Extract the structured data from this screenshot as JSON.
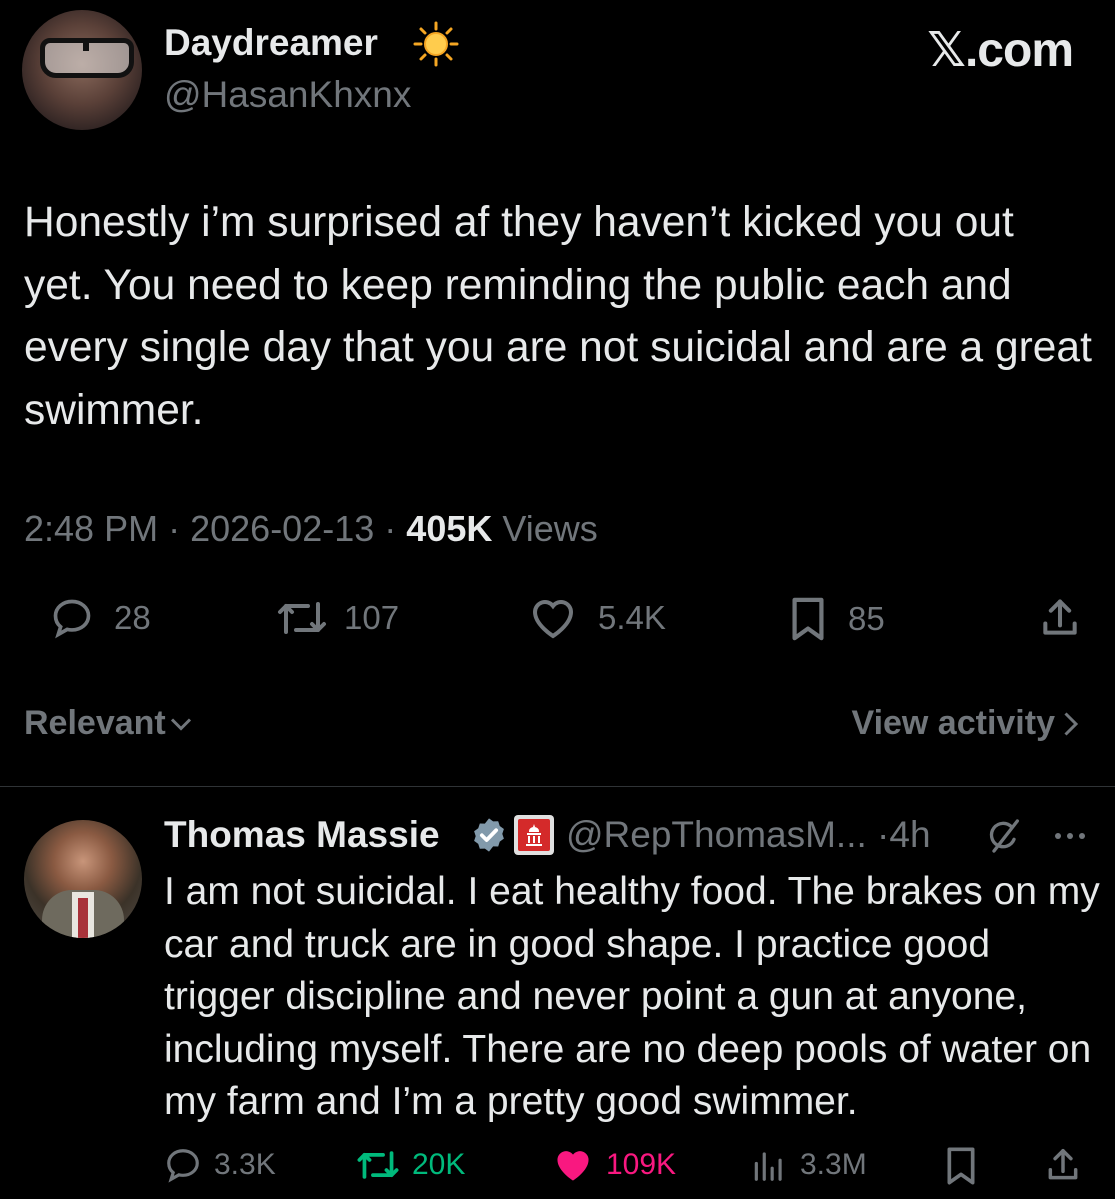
{
  "main_tweet": {
    "display_name": "Daydreamer",
    "name_emoji": "sun-emoji",
    "handle": "@HasanKhxnx",
    "site_label": ".com",
    "site_x": "𝕏",
    "text": "Honestly i’m surprised af they haven’t kicked you out yet. You need to keep reminding the public each and every single day that you are not suicidal and are a great swimmer.",
    "time": "2:48 PM",
    "sep1": "·",
    "date": "2026-02-13",
    "sep2": "·",
    "views_count": "405K",
    "views_label": "Views",
    "replies": "28",
    "reposts": "107",
    "likes": "5.4K",
    "bookmarks": "85"
  },
  "sort": {
    "relevant_label": "Relevant",
    "view_activity_label": "View activity"
  },
  "reply": {
    "display_name": "Thomas Massie",
    "handle": "@RepThomasM...",
    "dot": "·",
    "age": "4h",
    "text": "I am not suicidal. I eat healthy food. The brakes on my car and truck are in good shape. I practice good trigger discipline and never point a gun at anyone, including myself. There are no deep pools of water on my farm and I’m a pretty good swimmer.",
    "replies": "3.3K",
    "reposts": "20K",
    "likes": "109K",
    "views": "3.3M"
  },
  "colors": {
    "background": "#000000",
    "text": "#e7e9ea",
    "muted": "#71767b",
    "repost_active": "#00ba7c",
    "like_active": "#f91880",
    "verified": "#1d9bf0"
  }
}
